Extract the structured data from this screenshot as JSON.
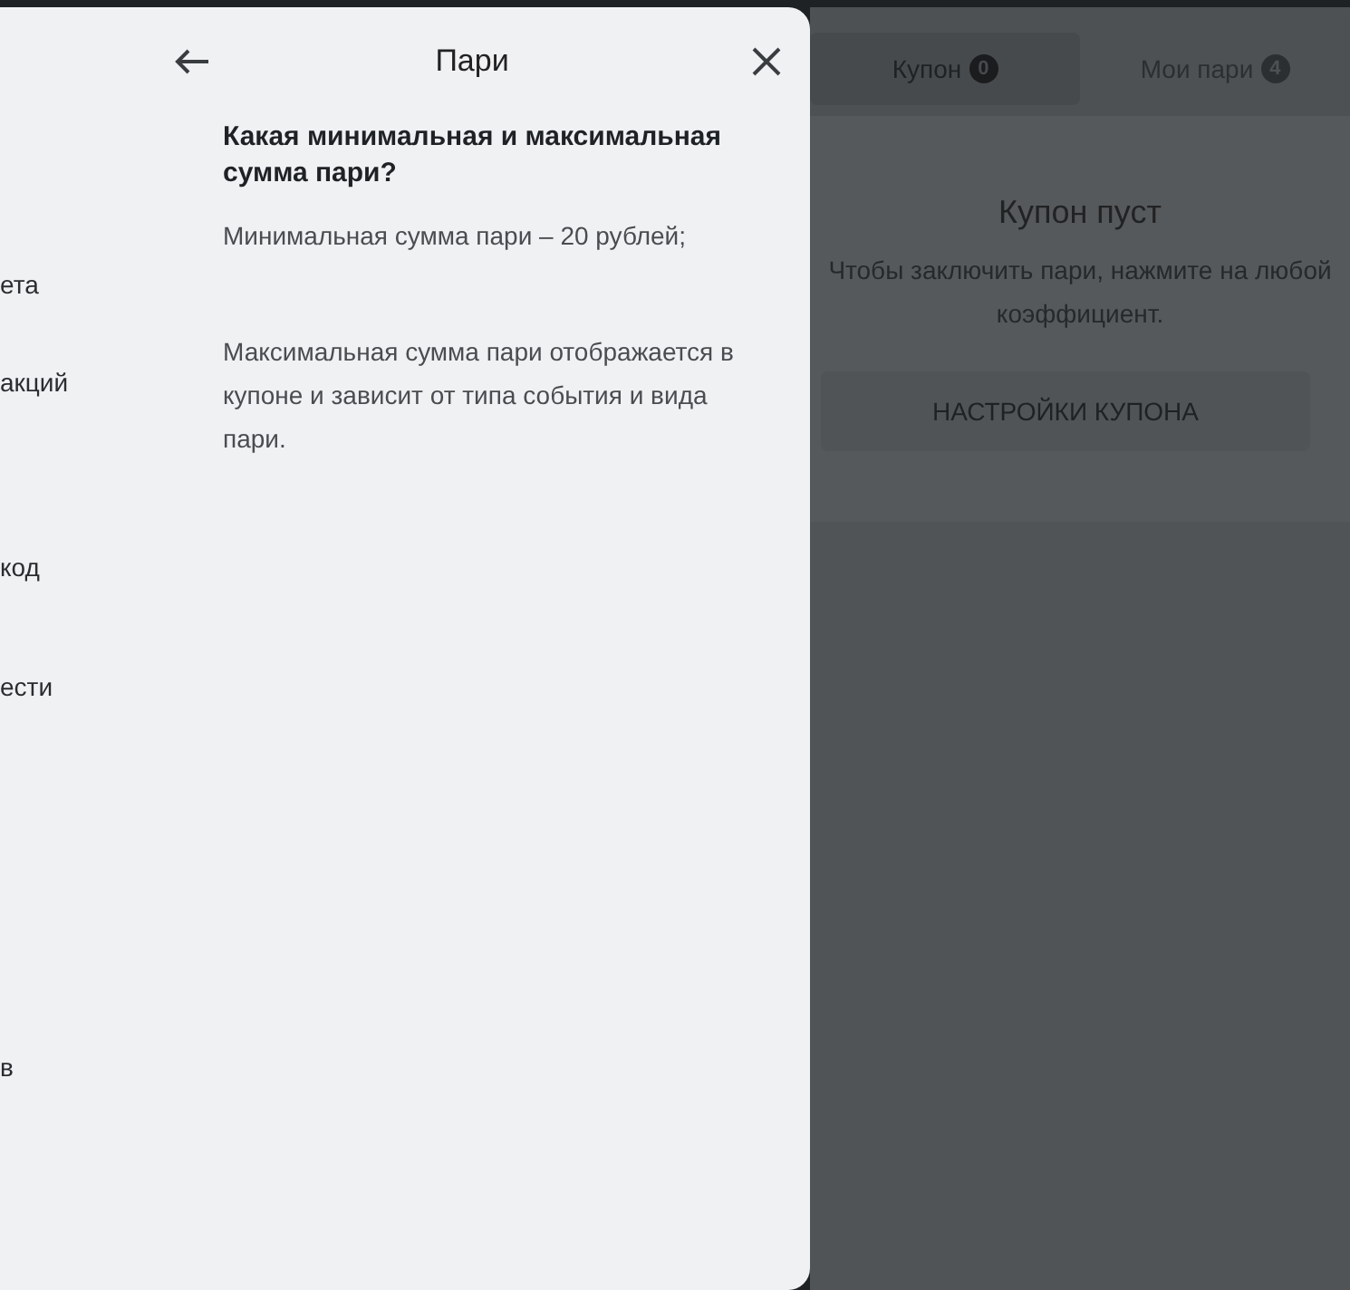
{
  "back_menu": {
    "items": [
      "ета",
      "акций",
      "код",
      "ести",
      "в"
    ]
  },
  "panel": {
    "title": "Пари",
    "question": "Какая минимальная и максимальная сумма пари?",
    "paragraphs": [
      "Минимальная сумма пари – 20 рублей;",
      "Максимальная сумма пари отображается в купоне и зависит от типа события и вида пари."
    ]
  },
  "coupon": {
    "tabs": [
      {
        "label": "Купон",
        "count": "0",
        "selected": true
      },
      {
        "label": "Мои пари",
        "count": "4",
        "selected": false
      }
    ],
    "empty_title": "Купон пуст",
    "empty_text": "Чтобы заключить пари, нажмите на любой коэффициент.",
    "settings_button": "НАСТРОЙКИ КУПОНА"
  }
}
